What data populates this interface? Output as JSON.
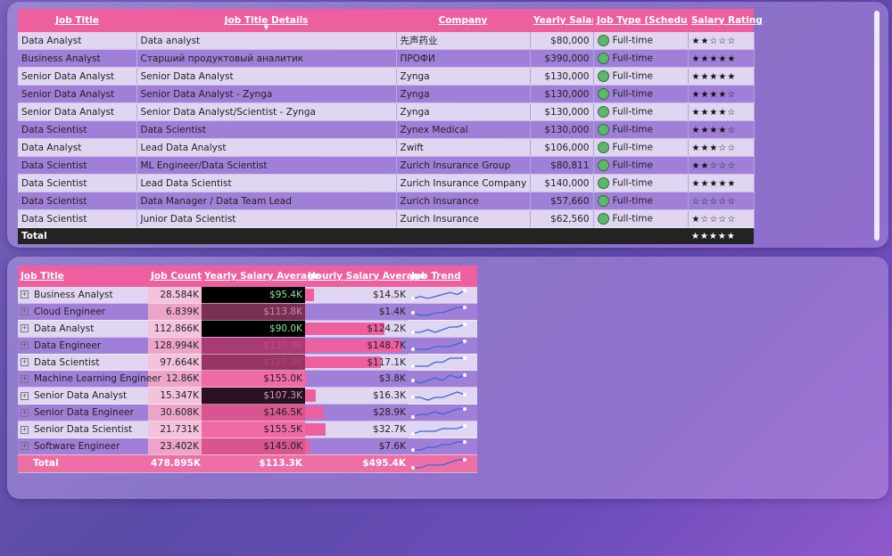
{
  "jobs_table": {
    "columns": [
      "Job Title",
      "Job Title Details",
      "Company",
      "Yearly Salary",
      "Job Type (Schedule)",
      "Salary Rating"
    ],
    "rows": [
      {
        "title": "Data Analyst",
        "details": "Data analyst",
        "company": "先声药业",
        "salary": "$80,000",
        "type": "Full-time",
        "rating": "★★☆☆☆"
      },
      {
        "title": "Business Analyst",
        "details": "Старший продуктовый аналитик",
        "company": "ПРОФИ",
        "salary": "$390,000",
        "type": "Full-time",
        "rating": "★★★★★"
      },
      {
        "title": "Senior Data Analyst",
        "details": "Senior Data Analyst",
        "company": "Zynga",
        "salary": "$130,000",
        "type": "Full-time",
        "rating": "★★★★★"
      },
      {
        "title": "Senior Data Analyst",
        "details": "Senior Data Analyst - Zynga",
        "company": "Zynga",
        "salary": "$130,000",
        "type": "Full-time",
        "rating": "★★★★☆"
      },
      {
        "title": "Senior Data Analyst",
        "details": "Senior Data Analyst/Scientist - Zynga",
        "company": "Zynga",
        "salary": "$130,000",
        "type": "Full-time",
        "rating": "★★★★☆"
      },
      {
        "title": "Data Scientist",
        "details": "Data Scientist",
        "company": "Zynex Medical",
        "salary": "$130,000",
        "type": "Full-time",
        "rating": "★★★★☆"
      },
      {
        "title": "Data Analyst",
        "details": "Lead Data Analyst",
        "company": "Zwift",
        "salary": "$106,000",
        "type": "Full-time",
        "rating": "★★★☆☆"
      },
      {
        "title": "Data Scientist",
        "details": "ML Engineer/Data Scientist",
        "company": "Zurich Insurance Group",
        "salary": "$80,811",
        "type": "Full-time",
        "rating": "★★☆☆☆"
      },
      {
        "title": "Data Scientist",
        "details": "Lead Data Scientist",
        "company": "Zurich Insurance Company Ltd.",
        "salary": "$140,000",
        "type": "Full-time",
        "rating": "★★★★★"
      },
      {
        "title": "Data Scientist",
        "details": "Data Manager / Data Team Lead",
        "company": "Zurich Insurance",
        "salary": "$57,660",
        "type": "Full-time",
        "rating": "☆☆☆☆☆"
      },
      {
        "title": "Data Scientist",
        "details": "Junior Data Scientist",
        "company": "Zurich Insurance",
        "salary": "$62,560",
        "type": "Full-time",
        "rating": "★☆☆☆☆"
      }
    ],
    "total": {
      "label": "Total",
      "rating": "★★★★★"
    }
  },
  "summary_table": {
    "columns": [
      "Job Title",
      "Job Count",
      "Yearly Salary Average",
      "Hourly Salary Average",
      "Job Trend"
    ],
    "rows": [
      {
        "title": "Business Analyst",
        "count": "28.584K",
        "yearly": "$95.4K",
        "yearly_bg": "#000000",
        "yearly_fg": "#8fe0a0",
        "hourly": "$14.5K",
        "hourly_frac": 0.09,
        "trend": [
          3,
          4,
          3,
          4,
          5,
          6,
          5,
          7
        ]
      },
      {
        "title": "Cloud Engineer",
        "count": "6.839K",
        "yearly": "$113.8K",
        "yearly_bg": "#7a2f55",
        "yearly_fg": "#c98aa8",
        "hourly": "$1.4K",
        "hourly_frac": 0.01,
        "trend": [
          4,
          3,
          3,
          4,
          4,
          5,
          6,
          6
        ]
      },
      {
        "title": "Data Analyst",
        "count": "112.866K",
        "yearly": "$90.0K",
        "yearly_bg": "#000000",
        "yearly_fg": "#8fe0a0",
        "hourly": "$124.2K",
        "hourly_frac": 0.77,
        "trend": [
          3,
          3,
          4,
          3,
          4,
          5,
          5,
          6
        ]
      },
      {
        "title": "Data Engineer",
        "count": "128.994K",
        "yearly": "$130.0K",
        "yearly_bg": "#a83c72",
        "yearly_fg": "#c44a86",
        "hourly": "$148.7K",
        "hourly_frac": 0.93,
        "trend": [
          3,
          3,
          3,
          4,
          4,
          4,
          5,
          6
        ]
      },
      {
        "title": "Data Scientist",
        "count": "97.664K",
        "yearly": "$127.0K",
        "yearly_bg": "#963566",
        "yearly_fg": "#b04278",
        "hourly": "$117.1K",
        "hourly_frac": 0.73,
        "trend": [
          3,
          3,
          3,
          4,
          4,
          5,
          5,
          5
        ]
      },
      {
        "title": "Machine Learning Engineer",
        "count": "12.86K",
        "yearly": "$155.0K",
        "yearly_bg": "#f06aa6",
        "yearly_fg": "#222222",
        "hourly": "$3.8K",
        "hourly_frac": 0.02,
        "trend": [
          4,
          3,
          4,
          5,
          4,
          6,
          5,
          6
        ]
      },
      {
        "title": "Senior Data Analyst",
        "count": "15.347K",
        "yearly": "$107.3K",
        "yearly_bg": "#2a1020",
        "yearly_fg": "#c9a0b8",
        "hourly": "$16.3K",
        "hourly_frac": 0.1,
        "trend": [
          4,
          4,
          3,
          4,
          4,
          5,
          6,
          5
        ]
      },
      {
        "title": "Senior Data Engineer",
        "count": "30.608K",
        "yearly": "$146.5K",
        "yearly_bg": "#d8558f",
        "yearly_fg": "#222222",
        "hourly": "$28.9K",
        "hourly_frac": 0.18,
        "trend": [
          3,
          4,
          4,
          5,
          4,
          5,
          6,
          6
        ]
      },
      {
        "title": "Senior Data Scientist",
        "count": "21.731K",
        "yearly": "$155.5K",
        "yearly_bg": "#f06aa6",
        "yearly_fg": "#222222",
        "hourly": "$32.7K",
        "hourly_frac": 0.2,
        "trend": [
          3,
          4,
          4,
          4,
          5,
          5,
          5,
          6
        ]
      },
      {
        "title": "Software Engineer",
        "count": "23.402K",
        "yearly": "$145.0K",
        "yearly_bg": "#d8558f",
        "yearly_fg": "#222222",
        "hourly": "$7.6K",
        "hourly_frac": 0.05,
        "trend": [
          3,
          3,
          4,
          4,
          5,
          5,
          6,
          6
        ]
      }
    ],
    "total": {
      "label": "Total",
      "count": "478.895K",
      "yearly": "$113.3K",
      "hourly": "$495.4K",
      "trend": [
        3,
        3,
        4,
        4,
        4,
        5,
        6,
        6
      ]
    }
  },
  "colors": {
    "header": "#ee5fa0",
    "status": "#5db86d",
    "trend_line": "#3b67d6"
  }
}
